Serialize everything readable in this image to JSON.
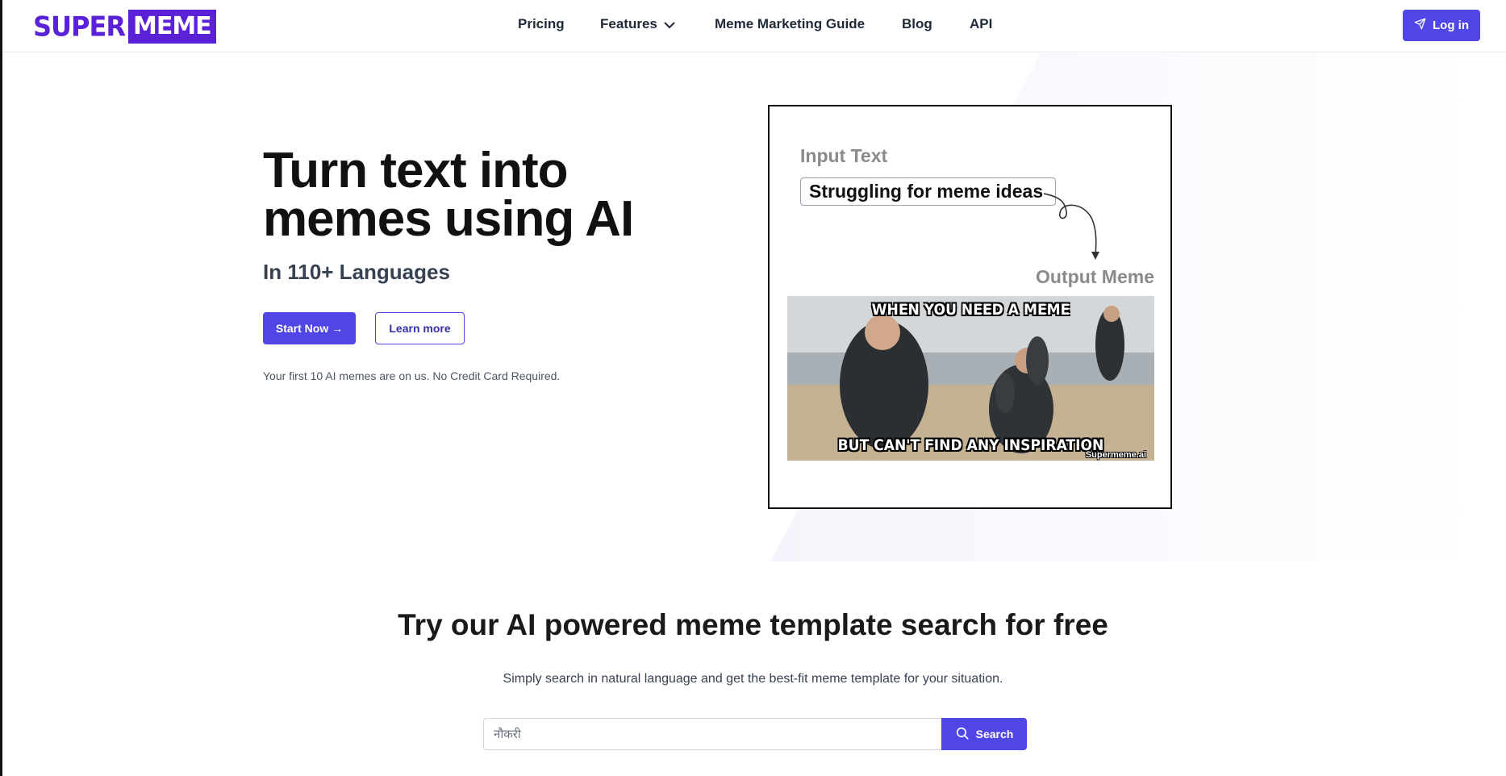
{
  "brand": {
    "super": "SUPER",
    "meme": "MEME",
    "color": "#5b21d6"
  },
  "nav": {
    "items": [
      {
        "label": "Pricing"
      },
      {
        "label": "Features"
      },
      {
        "label": "Meme Marketing Guide"
      },
      {
        "label": "Blog"
      },
      {
        "label": "API"
      }
    ],
    "login_label": "Log in",
    "login_icon": "send-icon",
    "features_icon": "chevron-down-icon"
  },
  "hero": {
    "title": "Turn text into memes using AI",
    "subtitle": "In 110+ Languages",
    "start_label": "Start Now →",
    "learn_label": "Learn more",
    "note": "Your first 10 AI memes are on us. No Credit Card Required."
  },
  "demo": {
    "input_label": "Input Text",
    "input_text": "Struggling for meme ideas",
    "output_label": "Output Meme",
    "meme_top": "WHEN YOU NEED A MEME",
    "meme_bottom": "BUT CAN'T FIND ANY INSPIRATION",
    "watermark": "Supermeme.ai"
  },
  "search": {
    "title": "Try our AI powered meme template search for free",
    "subtitle": "Simply search in natural language and get the best-fit meme template for your situation.",
    "value": "नौकरी",
    "button_label": "Search",
    "button_icon": "search-icon"
  },
  "colors": {
    "accent": "#4f46e5",
    "text": "#111111"
  }
}
